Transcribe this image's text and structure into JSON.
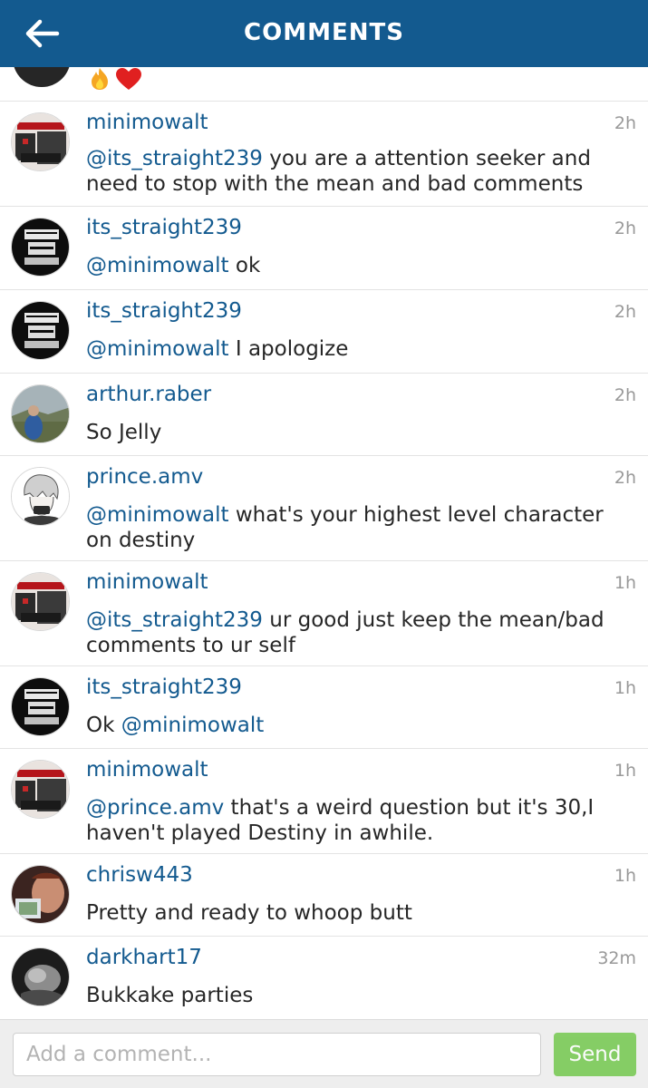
{
  "header": {
    "title": "COMMENTS",
    "back_icon": "arrow-left-icon",
    "color": "#135a8f"
  },
  "top_partial": {
    "emojis": [
      "fire",
      "red-heart"
    ]
  },
  "comments": [
    {
      "username": "minimowalt",
      "time": "2h",
      "mention": "@its_straight239",
      "text": " you are a attention seeker and need to stop with the mean and bad comments",
      "avatar": "minimowalt"
    },
    {
      "username": "its_straight239",
      "time": "2h",
      "mention": "@minimowalt",
      "text": " ok",
      "avatar": "straight-outta"
    },
    {
      "username": "its_straight239",
      "time": "2h",
      "mention": "@minimowalt",
      "text": " I apologize",
      "avatar": "straight-outta"
    },
    {
      "username": "arthur.raber",
      "time": "2h",
      "mention": "",
      "text": "So Jelly",
      "avatar": "outdoor"
    },
    {
      "username": "prince.amv",
      "time": "2h",
      "mention": "@minimowalt",
      "text": " what's your highest level character on destiny",
      "avatar": "anime"
    },
    {
      "username": "minimowalt",
      "time": "1h",
      "mention": "@its_straight239",
      "text": " ur good just keep the mean/bad comments to ur self",
      "avatar": "minimowalt"
    },
    {
      "username": "its_straight239",
      "time": "1h",
      "prefix": "Ok ",
      "mention": "@minimowalt",
      "text": "",
      "avatar": "straight-outta"
    },
    {
      "username": "minimowalt",
      "time": "1h",
      "mention": "@prince.amv",
      "text": " that's a weird question but it's 30,I haven't played Destiny in awhile.",
      "avatar": "minimowalt"
    },
    {
      "username": "chrisw443",
      "time": "1h",
      "mention": "",
      "text": "Pretty and ready to whoop butt",
      "avatar": "selfie"
    },
    {
      "username": "darkhart17",
      "time": "32m",
      "mention": "",
      "text": "Bukkake parties",
      "avatar": "bw-photo"
    }
  ],
  "composer": {
    "placeholder": "Add a comment...",
    "send_label": "Send",
    "send_color": "#6cc644"
  }
}
